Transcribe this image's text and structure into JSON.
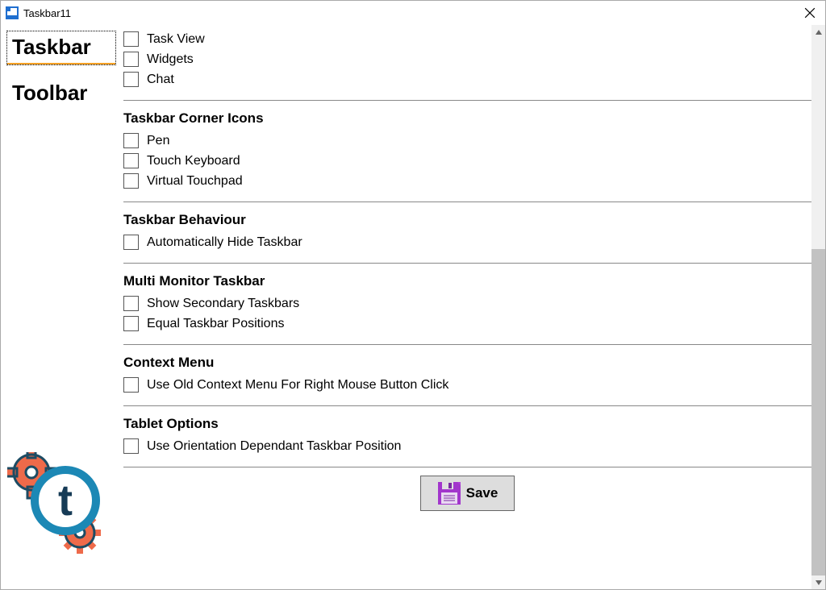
{
  "window": {
    "title": "Taskbar11"
  },
  "sidebar": {
    "tabs": [
      {
        "label": "Taskbar",
        "active": true
      },
      {
        "label": "Toolbar",
        "active": false
      }
    ]
  },
  "sections": {
    "top_items": [
      {
        "label": "Task View"
      },
      {
        "label": "Widgets"
      },
      {
        "label": "Chat"
      }
    ],
    "corner_icons": {
      "header": "Taskbar Corner Icons",
      "items": [
        {
          "label": "Pen"
        },
        {
          "label": "Touch Keyboard"
        },
        {
          "label": "Virtual Touchpad"
        }
      ]
    },
    "behaviour": {
      "header": "Taskbar Behaviour",
      "items": [
        {
          "label": "Automatically Hide Taskbar"
        }
      ]
    },
    "multimonitor": {
      "header": "Multi Monitor Taskbar",
      "items": [
        {
          "label": "Show Secondary Taskbars"
        },
        {
          "label": "Equal Taskbar Positions"
        }
      ]
    },
    "contextmenu": {
      "header": "Context Menu",
      "items": [
        {
          "label": "Use Old Context Menu For Right Mouse Button Click"
        }
      ]
    },
    "tablet": {
      "header": "Tablet Options",
      "items": [
        {
          "label": "Use Orientation Dependant Taskbar Position"
        }
      ]
    }
  },
  "buttons": {
    "save": "Save"
  }
}
